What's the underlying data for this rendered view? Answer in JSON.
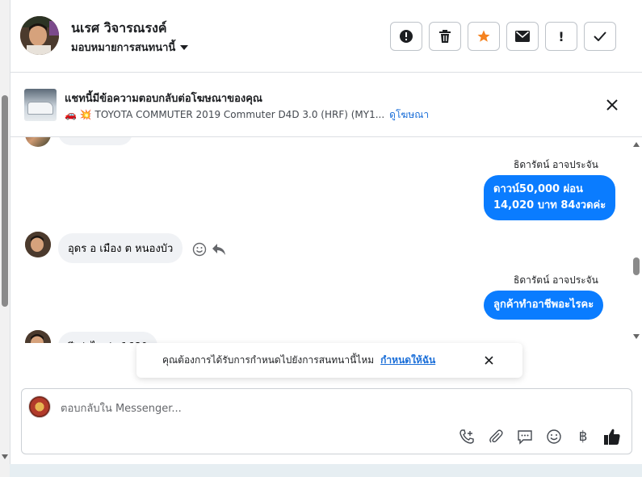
{
  "header": {
    "user_name": "นเรศ วิจารณรงค์",
    "assign_label": "มอบหมายการสนทนานี้",
    "actions": [
      {
        "name": "report-button",
        "icon": "alert-circle-icon"
      },
      {
        "name": "delete-button",
        "icon": "trash-icon"
      },
      {
        "name": "star-button",
        "icon": "star-icon",
        "color": "#f5821f"
      },
      {
        "name": "mark-unread-button",
        "icon": "envelope-icon"
      },
      {
        "name": "follow-up-button",
        "icon": "exclamation-icon",
        "glyph": "!"
      },
      {
        "name": "done-button",
        "icon": "check-icon"
      }
    ]
  },
  "ad": {
    "title": "แชทนี้มีข้อความตอบกลับต่อโฆษณาของคุณ",
    "subtitle": "🚗 💥 TOYOTA COMMUTER 2019 Commuter D4D 3.0 (HRF) (MY1...",
    "link": "ดูโฆษณา"
  },
  "messages": [
    {
      "sender": "ธิดารัตน์ อาจประจัน",
      "text_line1": "ดาวน์50,000 ผ่อน",
      "text_line2": "14,020 บาท 84งวดค่ะ",
      "direction": "out"
    },
    {
      "text": "อุดร อ เมือง ต หนองบัว",
      "direction": "in"
    },
    {
      "sender": "ธิดารัตน์ อาจประจัน",
      "text": "ลูกค้าทำอาชีพอะไรคะ",
      "direction": "out"
    },
    {
      "text": "ปีเท่าไรเก่า 1680",
      "direction": "in"
    }
  ],
  "toast": {
    "text": "คุณต้องการได้รับการกำหนดไปยังการสนทนานี้ไหม",
    "link": "กำหนดให้ฉัน"
  },
  "composer": {
    "placeholder": "ตอบกลับใน Messenger...",
    "currency_symbol": "฿"
  },
  "colors": {
    "bubble_out": "#0a7cff",
    "bubble_in": "#f0f2f5",
    "link": "#1a6ed8",
    "star": "#f5821f"
  }
}
